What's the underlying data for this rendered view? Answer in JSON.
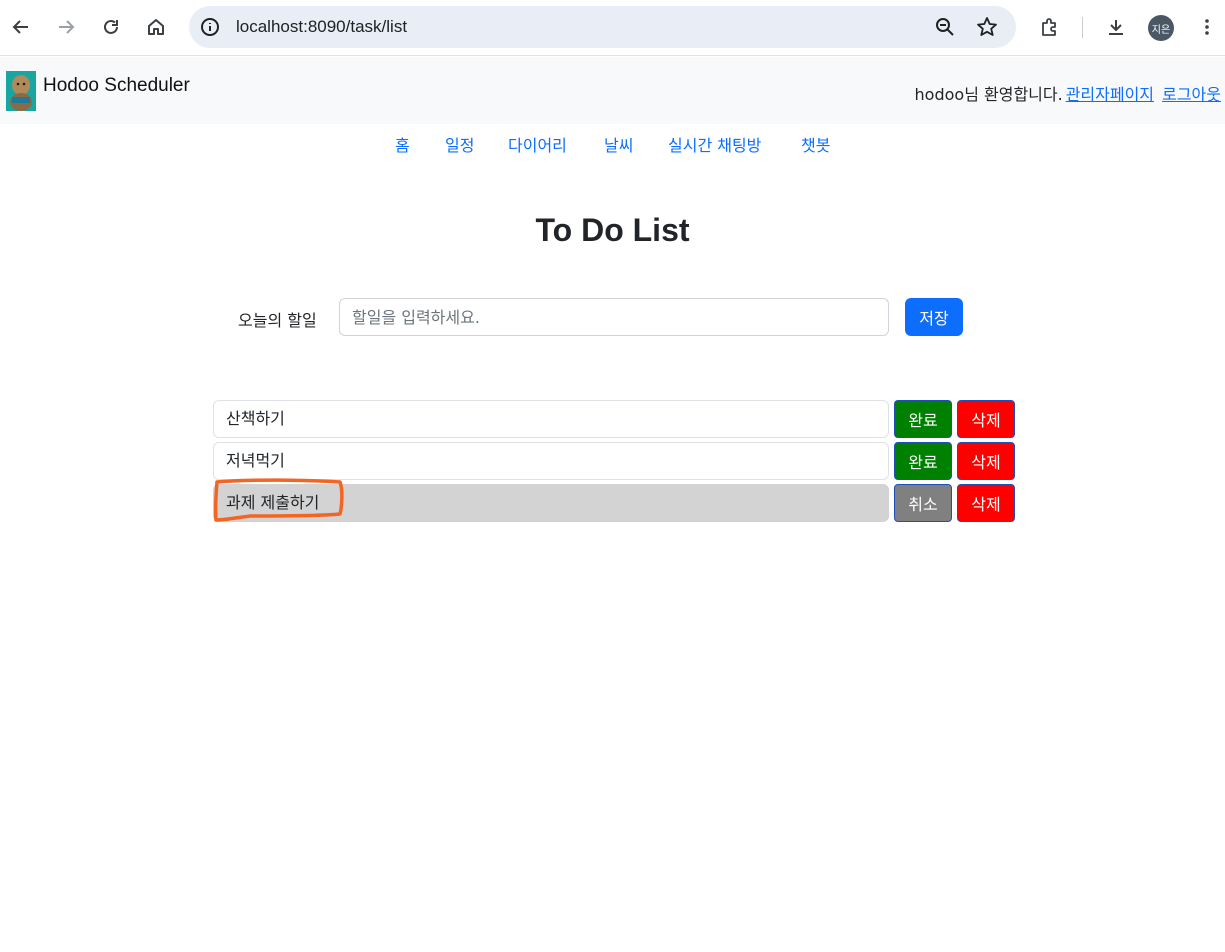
{
  "browser": {
    "url": "localhost:8090/task/list",
    "profile_initials": "지은",
    "icons": [
      "back-icon",
      "forward-icon",
      "reload-icon",
      "home-icon",
      "info-icon",
      "zoom-icon",
      "bookmark-star-icon",
      "extensions-icon",
      "download-icon",
      "menu-dots-icon"
    ]
  },
  "header": {
    "brand": "Hodoo Scheduler",
    "welcome": "hodoo님 환영합니다.",
    "admin_link": "관리자페이지",
    "logout_link": "로그아웃"
  },
  "nav": {
    "items": [
      {
        "label": "홈"
      },
      {
        "label": "일정"
      },
      {
        "label": "다이어리"
      },
      {
        "label": "날씨"
      },
      {
        "label": "실시간 채팅방"
      },
      {
        "label": "챗봇"
      }
    ]
  },
  "main": {
    "title": "To Do List",
    "form": {
      "label": "오늘의 할일",
      "placeholder": "할일을 입력하세요.",
      "value": "",
      "save_label": "저장"
    },
    "tasks": [
      {
        "text": "산책하기",
        "done": false,
        "toggle_label": "완료",
        "delete_label": "삭제"
      },
      {
        "text": "저녁먹기",
        "done": false,
        "toggle_label": "완료",
        "delete_label": "삭제"
      },
      {
        "text": "과제 제출하기",
        "done": true,
        "toggle_label": "취소",
        "delete_label": "삭제"
      }
    ]
  },
  "colors": {
    "primary": "#0d6efd",
    "complete": "#008000",
    "cancel": "#808080",
    "delete": "#ff0000",
    "done_row": "#d3d3d3",
    "annotation": "#f26522"
  }
}
